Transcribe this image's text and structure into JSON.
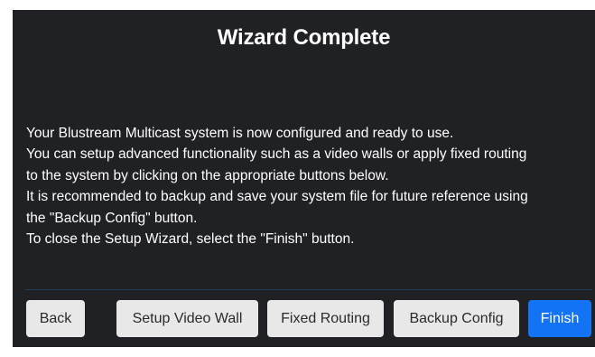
{
  "dialog": {
    "title": "Wizard Complete",
    "message_lines": [
      "Your Blustream Multicast system is now configured and ready to use.",
      "You can setup advanced functionality such as a video walls or apply fixed routing",
      "to the system by clicking on the appropriate buttons below.",
      "It is recommended to backup and save your system file for future reference using",
      "the \"Backup Config\" button.",
      "To close the Setup Wizard, select the \"Finish\" button."
    ]
  },
  "buttons": {
    "back": "Back",
    "setup_video_wall": "Setup Video Wall",
    "fixed_routing": "Fixed Routing",
    "backup_config": "Backup Config",
    "finish": "Finish"
  },
  "colors": {
    "dialog_background": "#202124",
    "primary_button": "#1273f5",
    "secondary_button": "#e8e8e8",
    "divider": "#1e3b57"
  }
}
